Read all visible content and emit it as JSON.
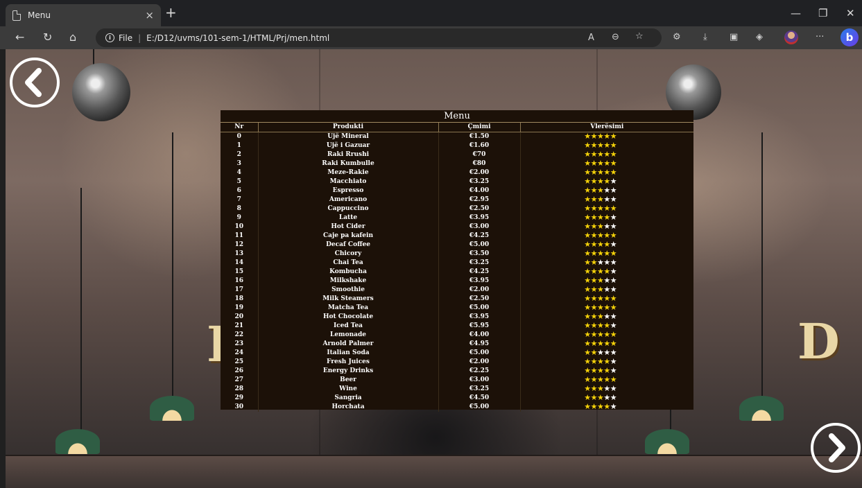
{
  "browser": {
    "tab_title": "Menu",
    "tab_close": "×",
    "new_tab": "+",
    "url_prefix": "File",
    "url": "E:/D12/uvms/101-sem-1/HTML/Prj/men.html",
    "bing_label": "b"
  },
  "menu": {
    "title": "Menu",
    "headers": {
      "nr": "Nr",
      "product": "Produkti",
      "price": "Çmimi",
      "rating": "Vlerësimi"
    },
    "items": [
      {
        "nr": "0",
        "name": "Ujë Mineral",
        "price": "€1.50",
        "stars": 5
      },
      {
        "nr": "1",
        "name": "Ujë i Gazuar",
        "price": "€1.60",
        "stars": 5
      },
      {
        "nr": "2",
        "name": "Raki Rrushi",
        "price": "€70",
        "stars": 5
      },
      {
        "nr": "3",
        "name": "Raki Kumbulle",
        "price": "€80",
        "stars": 5
      },
      {
        "nr": "4",
        "name": "Meze-Rakie",
        "price": "€2.00",
        "stars": 5
      },
      {
        "nr": "5",
        "name": "Macchiato",
        "price": "€3.25",
        "stars": 4
      },
      {
        "nr": "6",
        "name": "Espresso",
        "price": "€4.00",
        "stars": 3
      },
      {
        "nr": "7",
        "name": "Americano",
        "price": "€2.95",
        "stars": 3
      },
      {
        "nr": "8",
        "name": "Cappuccino",
        "price": "€2.50",
        "stars": 5
      },
      {
        "nr": "9",
        "name": "Latte",
        "price": "€3.95",
        "stars": 4
      },
      {
        "nr": "10",
        "name": "Hot Cider",
        "price": "€3.00",
        "stars": 3
      },
      {
        "nr": "11",
        "name": "Caje pa kafein",
        "price": "€4.25",
        "stars": 5
      },
      {
        "nr": "12",
        "name": "Decaf Coffee",
        "price": "€5.00",
        "stars": 4
      },
      {
        "nr": "13",
        "name": "Chicory",
        "price": "€3.50",
        "stars": 5
      },
      {
        "nr": "14",
        "name": "Chai Tea",
        "price": "€3.25",
        "stars": 2
      },
      {
        "nr": "15",
        "name": "Kombucha",
        "price": "€4.25",
        "stars": 4
      },
      {
        "nr": "16",
        "name": "Milkshake",
        "price": "€3.95",
        "stars": 3
      },
      {
        "nr": "17",
        "name": "Smoothie",
        "price": "€2.00",
        "stars": 3
      },
      {
        "nr": "18",
        "name": "Milk Steamers",
        "price": "€2.50",
        "stars": 5
      },
      {
        "nr": "19",
        "name": "Matcha Tea",
        "price": "€5.00",
        "stars": 5
      },
      {
        "nr": "20",
        "name": "Hot Chocolate",
        "price": "€3.95",
        "stars": 3
      },
      {
        "nr": "21",
        "name": "Iced Tea",
        "price": "€5.95",
        "stars": 4
      },
      {
        "nr": "22",
        "name": "Lemonade",
        "price": "€4.00",
        "stars": 5
      },
      {
        "nr": "23",
        "name": "Arnold Palmer",
        "price": "€4.95",
        "stars": 5
      },
      {
        "nr": "24",
        "name": "Italian Soda",
        "price": "€5.00",
        "stars": 2
      },
      {
        "nr": "25",
        "name": "Fresh Juices",
        "price": "€2.00",
        "stars": 4
      },
      {
        "nr": "26",
        "name": "Energy Drinks",
        "price": "€2.25",
        "stars": 4
      },
      {
        "nr": "27",
        "name": "Beer",
        "price": "€3.00",
        "stars": 5
      },
      {
        "nr": "28",
        "name": "Wine",
        "price": "€3.25",
        "stars": 3
      },
      {
        "nr": "29",
        "name": "Sangria",
        "price": "€4.50",
        "stars": 3
      },
      {
        "nr": "30",
        "name": "Horchata",
        "price": "€5.00",
        "stars": 4
      }
    ]
  },
  "colors": {
    "star_on": "#f5d20a",
    "star_off": "#ffffff",
    "table_bg": "#1c1108"
  },
  "icons": {
    "prev": "chevron-left-icon",
    "next": "chevron-right-icon"
  }
}
